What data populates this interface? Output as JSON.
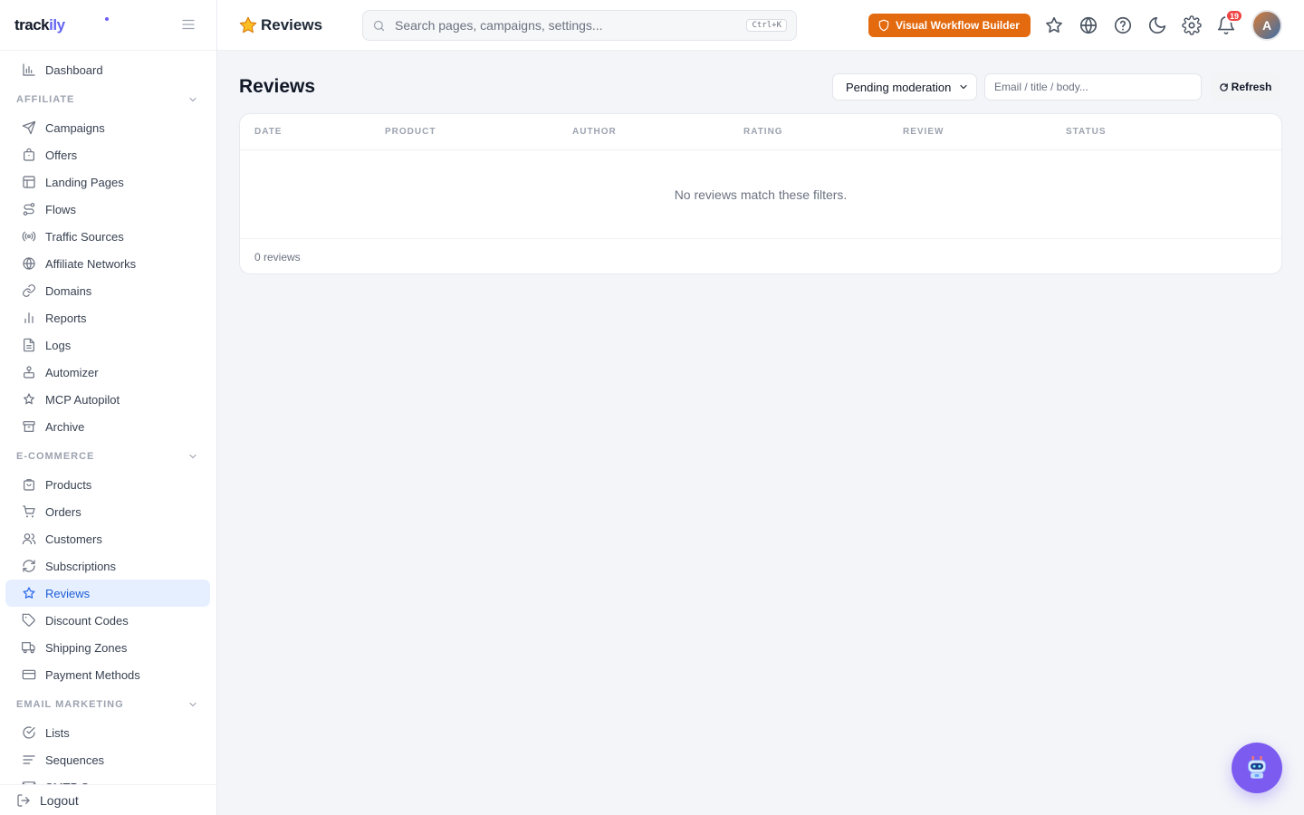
{
  "brand": {
    "name_part1": "track",
    "name_part2": "ily"
  },
  "sidebar": {
    "top_items": [
      {
        "label": "Dashboard",
        "icon": "chart-icon"
      }
    ],
    "sections": [
      {
        "title": "AFFILIATE",
        "items": [
          {
            "label": "Campaigns",
            "icon": "send-icon"
          },
          {
            "label": "Offers",
            "icon": "bag-icon"
          },
          {
            "label": "Landing Pages",
            "icon": "layout-icon"
          },
          {
            "label": "Flows",
            "icon": "route-icon"
          },
          {
            "label": "Traffic Sources",
            "icon": "radio-icon"
          },
          {
            "label": "Affiliate Networks",
            "icon": "globe-icon"
          },
          {
            "label": "Domains",
            "icon": "link-icon"
          },
          {
            "label": "Reports",
            "icon": "bar-chart-icon"
          },
          {
            "label": "Logs",
            "icon": "file-icon"
          },
          {
            "label": "Automizer",
            "icon": "bot-icon"
          },
          {
            "label": "MCP Autopilot",
            "icon": "sparkle-icon"
          },
          {
            "label": "Archive",
            "icon": "archive-icon"
          }
        ]
      },
      {
        "title": "E-COMMERCE",
        "items": [
          {
            "label": "Products",
            "icon": "package-icon"
          },
          {
            "label": "Orders",
            "icon": "cart-icon"
          },
          {
            "label": "Customers",
            "icon": "users-icon"
          },
          {
            "label": "Subscriptions",
            "icon": "refresh-icon"
          },
          {
            "label": "Reviews",
            "icon": "star-icon",
            "active": true
          },
          {
            "label": "Discount Codes",
            "icon": "tag-icon"
          },
          {
            "label": "Shipping Zones",
            "icon": "truck-icon"
          },
          {
            "label": "Payment Methods",
            "icon": "card-icon"
          }
        ]
      },
      {
        "title": "EMAIL MARKETING",
        "items": [
          {
            "label": "Lists",
            "icon": "check-circle-icon"
          },
          {
            "label": "Sequences",
            "icon": "lines-icon"
          },
          {
            "label": "SMTP Servers",
            "icon": "mail-icon"
          }
        ]
      }
    ],
    "logout_label": "Logout"
  },
  "header": {
    "title": "Reviews",
    "search_placeholder": "Search pages, campaigns, settings...",
    "search_shortcut": "Ctrl+K",
    "workflow_button": "Visual Workflow Builder",
    "notification_count": "19",
    "avatar_initial": "A"
  },
  "main": {
    "title": "Reviews",
    "status_filter": "Pending moderation",
    "search_placeholder": "Email / title / body...",
    "refresh_label": "Refresh",
    "columns": [
      "DATE",
      "PRODUCT",
      "AUTHOR",
      "RATING",
      "REVIEW",
      "STATUS"
    ],
    "empty_message": "No reviews match these filters.",
    "footer_count": "0 reviews"
  },
  "colors": {
    "accent": "#2563eb",
    "cta": "#e36a0f",
    "bot": "#7c5cf0"
  }
}
